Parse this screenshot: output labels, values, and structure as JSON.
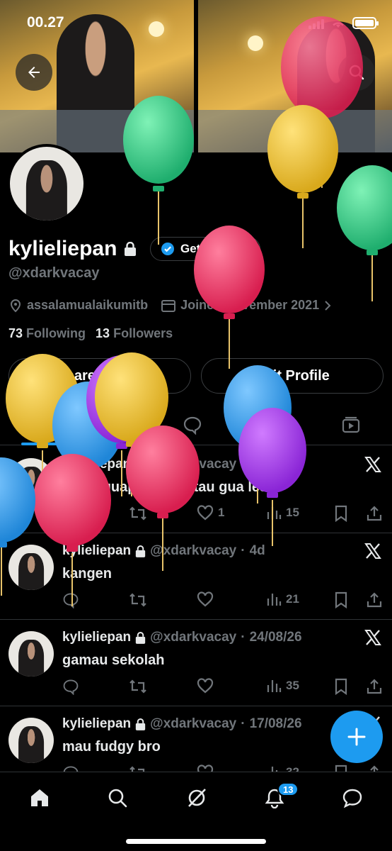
{
  "status_bar": {
    "time": "00.27"
  },
  "header": {
    "back_icon": "arrow-left-icon",
    "search_icon": "search-icon"
  },
  "profile": {
    "display_name": "kylieliepan",
    "handle": "@xdarkvacay",
    "verify_label": "Get verified",
    "location": "assalamualaikumitb",
    "joined": "Joined November 2021",
    "following_count": "73",
    "following_label": "Following",
    "followers_count": "13",
    "followers_label": "Followers",
    "share_label": "Share Profile",
    "edit_label": "Edit Profile"
  },
  "tabs": {
    "posts_label": "Posts"
  },
  "posts": [
    {
      "name": "kylieliepan",
      "handle": "@xdarkvacay",
      "time": "1d",
      "text": "ajakinguapacaran atau gua lesbi",
      "likes": "1",
      "views": "15"
    },
    {
      "name": "kylieliepan",
      "handle": "@xdarkvacay",
      "time": "4d",
      "text": "kangen",
      "likes": "",
      "views": "21"
    },
    {
      "name": "kylieliepan",
      "handle": "@xdarkvacay",
      "time": "24/08/26",
      "text": "gamau sekolah",
      "likes": "",
      "views": "35"
    },
    {
      "name": "kylieliepan",
      "handle": "@xdarkvacay",
      "time": "17/08/26",
      "text": "mau fudgy bro",
      "likes": "",
      "views": "32"
    }
  ],
  "nav": {
    "notifications_badge": "13"
  },
  "colors": {
    "accent": "#1d9bf0",
    "background": "#000000",
    "muted": "#71767b"
  }
}
